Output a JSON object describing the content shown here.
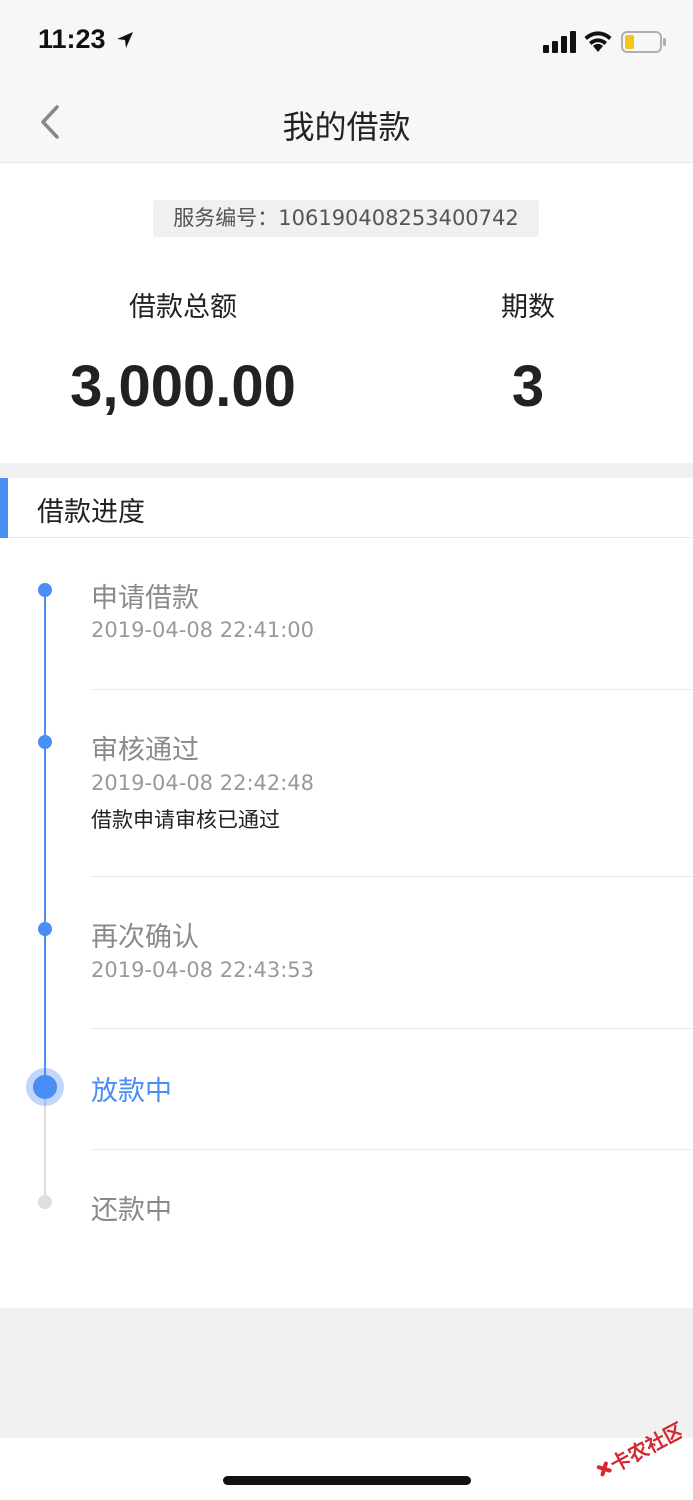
{
  "status_bar": {
    "time": "11:23"
  },
  "nav": {
    "title": "我的借款"
  },
  "summary": {
    "service_number": "服务编号：106190408253400742",
    "total_label": "借款总额",
    "total_value": "3,000.00",
    "periods_label": "期数",
    "periods_value": "3"
  },
  "progress": {
    "section_title": "借款进度",
    "steps": [
      {
        "title": "申请借款",
        "time": "2019-04-08 22:41:00"
      },
      {
        "title": "审核通过",
        "time": "2019-04-08 22:42:48",
        "note": "借款申请审核已通过"
      },
      {
        "title": "再次确认",
        "time": "2019-04-08 22:43:53"
      },
      {
        "title": "放款中",
        "state": "current"
      },
      {
        "title": "还款中",
        "state": "pending"
      }
    ]
  },
  "watermark": {
    "text": "卡农社区"
  },
  "colors": {
    "accent": "#4a8df4",
    "background_gray": "#f1f1f1",
    "battery_level": "#f5c518"
  },
  "icons": {
    "back": "chevron-left-icon",
    "location": "location-arrow-icon",
    "signal": "cellular-signal-icon",
    "wifi": "wifi-icon",
    "battery": "battery-icon"
  }
}
